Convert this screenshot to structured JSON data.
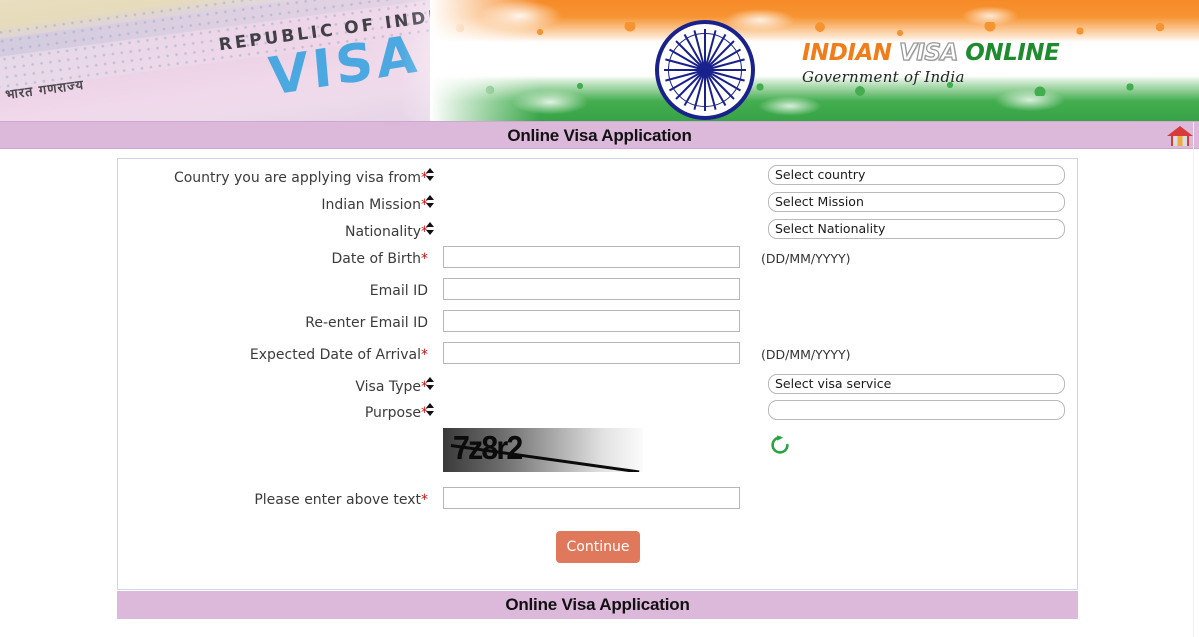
{
  "header": {
    "logo_primary": "INDIAN",
    "logo_secondary": "VISA",
    "logo_tertiary": "ONLINE",
    "logo_tagline": "Government of India",
    "visa_photo_text_republic": "REPUBLIC OF INDIA",
    "visa_photo_text_hindi": "भारत गणराज्य",
    "visa_photo_text_visa": "VISA",
    "emblem": "ashoka-chakra",
    "colors": {
      "saffron": "#f58220",
      "green": "#2f9e41",
      "chakra_blue": "#19218c",
      "logo_orange": "#f07d1a",
      "logo_green": "#1f8b2f"
    }
  },
  "titlebar": {
    "title": "Online Visa Application",
    "home_icon": "home-icon",
    "background": "#dcb8da"
  },
  "footerbar": {
    "title": "Online Visa Application",
    "background": "#dcb8da"
  },
  "form": {
    "fields": [
      {
        "label": "Country you are applying visa from",
        "required": true,
        "type": "select",
        "value": "Select country",
        "name": "country-applying-from"
      },
      {
        "label": "Indian Mission",
        "required": true,
        "type": "select",
        "value": "Select Mission",
        "name": "indian-mission"
      },
      {
        "label": "Nationality",
        "required": true,
        "type": "select",
        "value": "Select Nationality",
        "name": "nationality"
      },
      {
        "label": "Date of Birth",
        "required": true,
        "type": "text",
        "value": "",
        "placeholder": "",
        "hint": "(DD/MM/YYYY)",
        "name": "date-of-birth"
      },
      {
        "label": "Email ID",
        "required": false,
        "type": "text",
        "value": "",
        "placeholder": "",
        "hint": "",
        "name": "email-id"
      },
      {
        "label": "Re-enter Email ID",
        "required": false,
        "type": "text",
        "value": "",
        "placeholder": "",
        "hint": "",
        "name": "reenter-email-id"
      },
      {
        "label": "Expected Date of Arrival",
        "required": true,
        "type": "text",
        "value": "",
        "placeholder": "",
        "hint": "(DD/MM/YYYY)",
        "name": "expected-date-of-arrival"
      },
      {
        "label": "Visa Type",
        "required": true,
        "type": "select",
        "value": "Select visa service",
        "name": "visa-type"
      },
      {
        "label": "Purpose",
        "required": true,
        "type": "select",
        "value": "",
        "name": "purpose"
      }
    ],
    "captcha": {
      "text": "7z8r2",
      "refresh_icon": "refresh-icon",
      "refresh_color": "#2aa344",
      "input_label": "Please enter above text",
      "input_required": true,
      "input_value": ""
    },
    "submit": {
      "label": "Continue",
      "color": "#e0795c"
    }
  }
}
